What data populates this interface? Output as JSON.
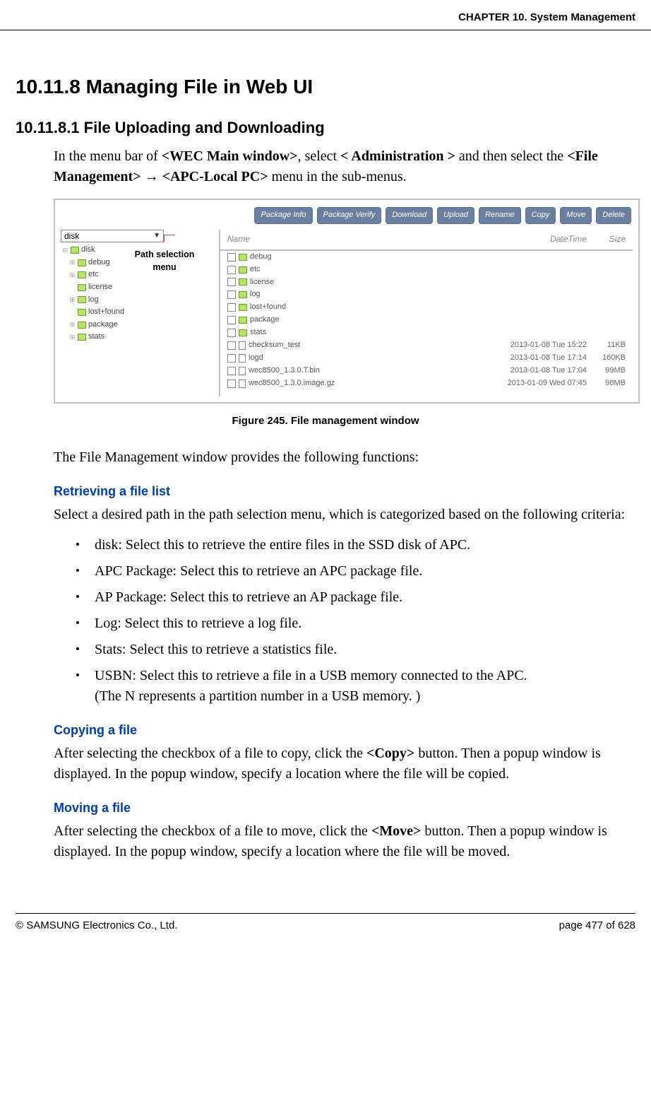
{
  "header": {
    "chapter": "CHAPTER 10. System Management"
  },
  "sections": {
    "major_num": "10.11.8",
    "major_title": "Managing File in Web UI",
    "minor_num": "10.11.8.1",
    "minor_title": "File Uploading and Downloading"
  },
  "intro": {
    "p1_a": "In the menu bar of ",
    "p1_b1": "<WEC Main window>",
    "p1_c": ", select ",
    "p1_b2": "< Administration >",
    "p1_d": " and then select the ",
    "p1_b3": "<File Management>",
    "p1_arrow": " → ",
    "p1_b4": "<APC-Local PC>",
    "p1_e": " menu in the sub-menus."
  },
  "figure": {
    "toolbar": [
      "Package Info",
      "Package Verify",
      "Download",
      "Upload",
      "Rename",
      "Copy",
      "Move",
      "Delete"
    ],
    "disk_label": "disk",
    "annotation": "Path selection menu",
    "tree": [
      "disk",
      "debug",
      "etc",
      "license",
      "log",
      "lost+found",
      "package",
      "stats"
    ],
    "headers": {
      "name": "Name",
      "dt": "DateTime",
      "size": "Size"
    },
    "folders": [
      "debug",
      "etc",
      "license",
      "log",
      "lost+found",
      "package",
      "stats"
    ],
    "files": [
      {
        "name": "checksum_test",
        "dt": "2013-01-08 Tue 15:22",
        "size": "11KB"
      },
      {
        "name": "logd",
        "dt": "2013-01-08 Tue 17:14",
        "size": "160KB"
      },
      {
        "name": "wec8500_1.3.0.T.bin",
        "dt": "2013-01-08 Tue 17:04",
        "size": "99MB"
      },
      {
        "name": "wec8500_1.3.0.image.gz",
        "dt": "2013-01-09 Wed 07:45",
        "size": "98MB"
      }
    ],
    "caption": "Figure 245. File management window"
  },
  "after_figure": "The File Management window provides the following functions:",
  "retrieve": {
    "head": "Retrieving a file list",
    "intro": "Select a desired path in the path selection menu, which is categorized based on the following criteria:",
    "items": [
      {
        "text": "disk: Select this to retrieve the entire files in the SSD disk of APC."
      },
      {
        "text": "APC Package: Select this to retrieve an APC package file."
      },
      {
        "text": "AP Package: Select this to retrieve an AP package file."
      },
      {
        "text": "Log: Select this to retrieve a log file."
      },
      {
        "text": "Stats: Select this to retrieve a statistics file."
      },
      {
        "text": "USBN: Select this to retrieve a file in a USB memory connected to the APC.",
        "sub": "(The N represents a partition number in a USB memory. )"
      }
    ]
  },
  "copying": {
    "head": "Copying a file",
    "p_a": "After selecting the checkbox of a file to copy, click the ",
    "p_b": "<Copy>",
    "p_c": " button. Then a popup window is displayed. In the popup window, specify a location where the file will be copied."
  },
  "moving": {
    "head": "Moving a file",
    "p_a": "After selecting the checkbox of a file to move, click the ",
    "p_b": "<Move>",
    "p_c": " button. Then a popup window is displayed. In the popup window, specify a location where the file will be moved."
  },
  "footer": {
    "copyright": "© SAMSUNG Electronics Co., Ltd.",
    "page": "page 477 of 628"
  }
}
